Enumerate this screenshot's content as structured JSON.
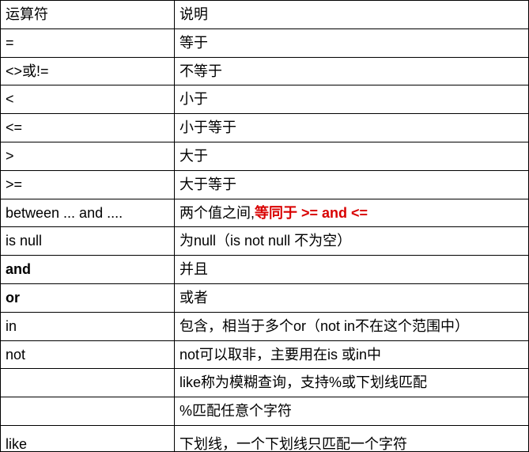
{
  "headers": {
    "operator": "运算符",
    "description": "说明"
  },
  "rows": [
    {
      "op": "=",
      "desc": "等于"
    },
    {
      "op": "<>或!=",
      "desc": "不等于"
    },
    {
      "op": "<",
      "desc": "小于"
    },
    {
      "op": "<=",
      "desc": "小于等于"
    },
    {
      "op": ">",
      "desc": "大于"
    },
    {
      "op": ">=",
      "desc": "大于等于"
    },
    {
      "op": "between ... and ....",
      "desc_pre": "两个值之间,",
      "desc_em": "等同于 >= and <="
    },
    {
      "op": "is null",
      "desc": "为null（is not null 不为空）"
    },
    {
      "op": "and",
      "op_bold": true,
      "desc": "并且"
    },
    {
      "op": "or",
      "op_bold": true,
      "desc": "或者"
    },
    {
      "op": "in",
      "desc": "包含，相当于多个or（not in不在这个范围中）"
    },
    {
      "op": "not",
      "desc": "not可以取非，主要用在is 或in中"
    },
    {
      "op": "like",
      "desc_lines": [
        "like称为模糊查询，支持%或下划线匹配",
        "%匹配任意个字符",
        "下划线，一个下划线只匹配一个字符"
      ]
    }
  ]
}
